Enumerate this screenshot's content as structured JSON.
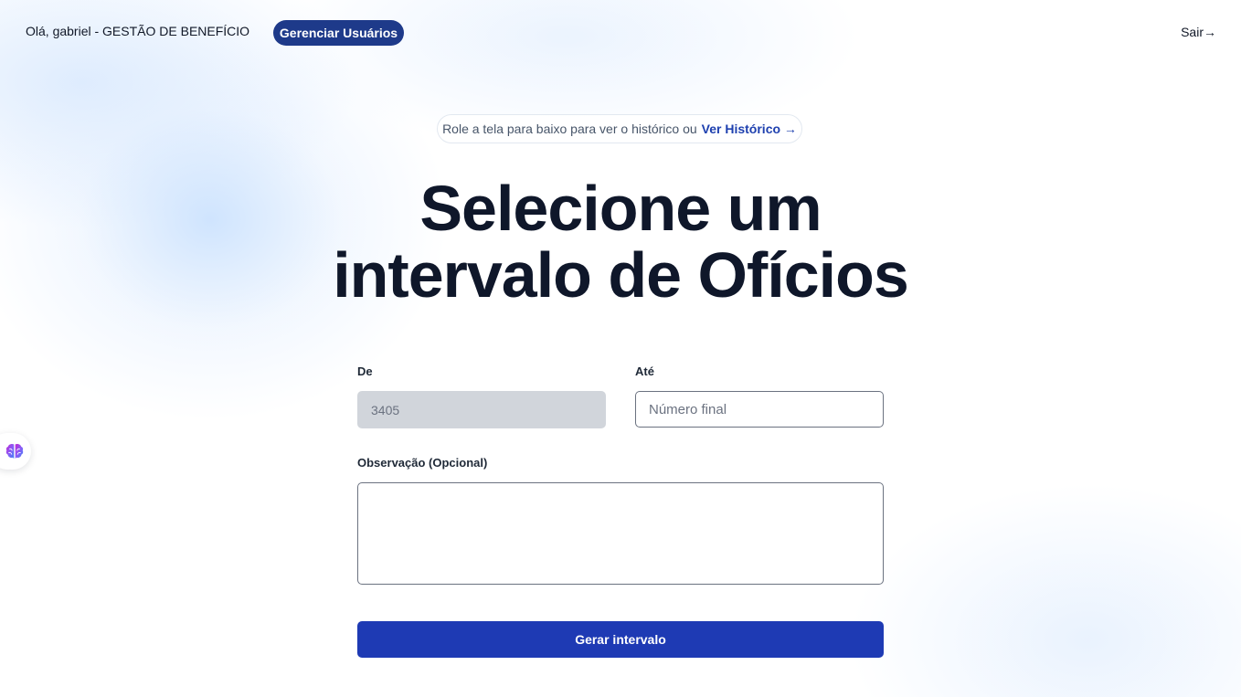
{
  "header": {
    "greeting": "Olá, gabriel - GESTÃO DE BENEFÍCIO",
    "manage_users_label": "Gerenciar Usuários",
    "logout_label": "Sair→"
  },
  "history": {
    "text": "Role a tela para baixo para ver o histórico ou",
    "link_label": "Ver Histórico →"
  },
  "main": {
    "title_line1": "Selecione um",
    "title_line2": "intervalo de Ofícios"
  },
  "form": {
    "from_label": "De",
    "from_value": "3405",
    "to_label": "Até",
    "to_placeholder": "Número final",
    "obs_label": "Observação (Opcional)",
    "obs_value": "",
    "submit_label": "Gerar intervalo"
  },
  "widget": {
    "icon": "brain-icon"
  },
  "colors": {
    "brand_dark": "#1e3a8a",
    "primary_button": "#1e3ab4",
    "link": "#1e40af",
    "disabled_input": "#d1d5db",
    "title_text": "#0f172a"
  }
}
